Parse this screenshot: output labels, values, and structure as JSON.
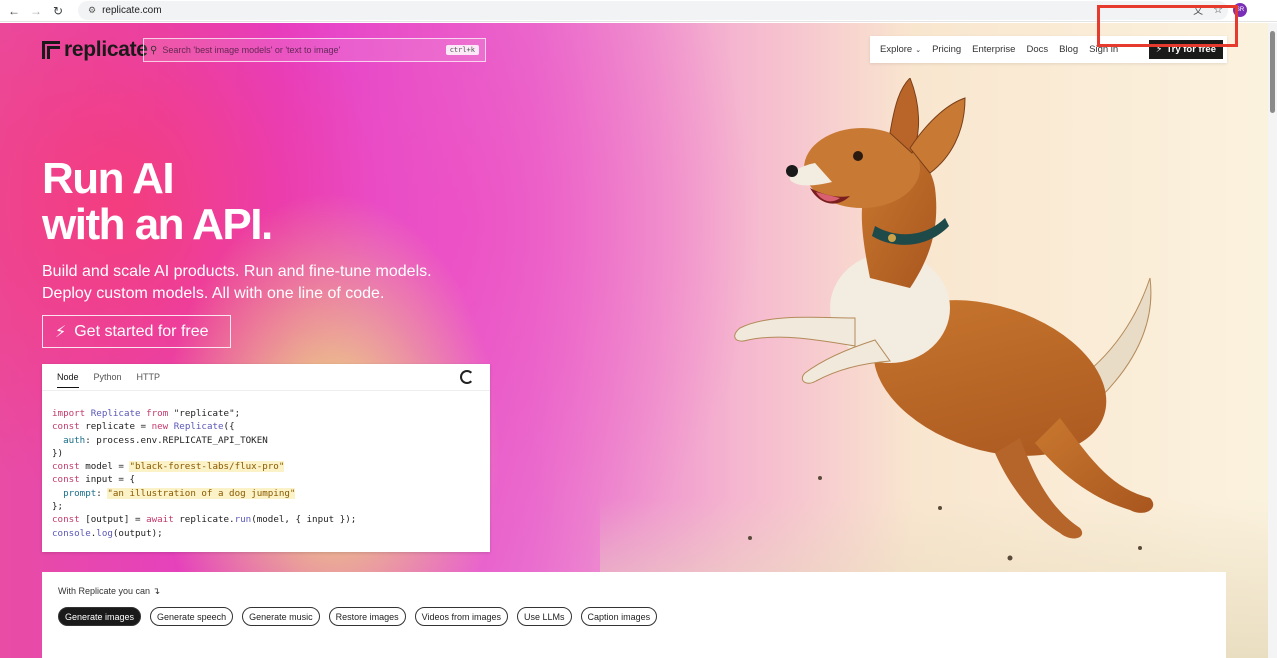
{
  "browser": {
    "url": "replicate.com",
    "avatar_initials": "SR"
  },
  "header": {
    "logo_text": "replicate",
    "search_placeholder": "Search 'best image models' or 'text to image'",
    "search_shortcut": "ctrl+k",
    "nav": [
      "Explore",
      "Pricing",
      "Enterprise",
      "Docs",
      "Blog"
    ],
    "sign_in": "Sign in",
    "try_free": "Try for free"
  },
  "hero": {
    "title_line1": "Run AI",
    "title_line2": "with an API.",
    "subtitle_line1": "Build and scale AI products. Run and fine-tune models.",
    "subtitle_line2": "Deploy custom models. All with one line of code.",
    "cta": "Get started for free"
  },
  "code_panel": {
    "tabs": [
      "Node",
      "Python",
      "HTTP"
    ],
    "active_tab": "Node",
    "model_string": "\"black-forest-labs/flux-pro\"",
    "prompt_string": "\"an illustration of a dog jumping\""
  },
  "capabilities": {
    "label": "With Replicate you can",
    "pills": [
      "Generate images",
      "Generate speech",
      "Generate music",
      "Restore images",
      "Videos from images",
      "Use LLMs",
      "Caption images"
    ],
    "active": "Generate images"
  },
  "colors": {
    "highlight": "#e53a2d",
    "dark": "#1a1a1a"
  }
}
